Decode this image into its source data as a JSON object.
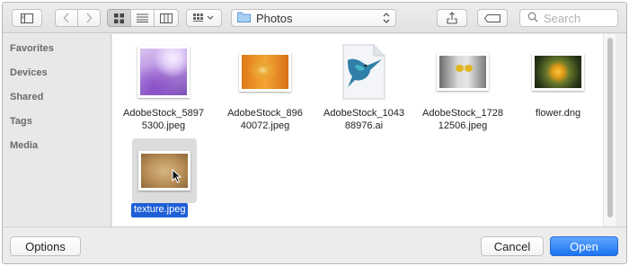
{
  "toolbar": {
    "location_label": "Photos",
    "search_placeholder": "Search"
  },
  "sidebar": {
    "items": [
      {
        "label": "Favorites"
      },
      {
        "label": "Devices"
      },
      {
        "label": "Shared"
      },
      {
        "label": "Tags"
      },
      {
        "label": "Media"
      }
    ]
  },
  "files": [
    {
      "line1": "AdobeStock_5897",
      "line2": "5300.jpeg"
    },
    {
      "line1": "AdobeStock_896",
      "line2": "40072.jpeg"
    },
    {
      "line1": "AdobeStock_1043",
      "line2": "88976.ai"
    },
    {
      "line1": "AdobeStock_1728",
      "line2": "12506.jpeg"
    },
    {
      "line1": "flower.dng",
      "line2": ""
    },
    {
      "line1": "texture.jpeg",
      "line2": ""
    }
  ],
  "footer": {
    "options_label": "Options",
    "cancel_label": "Cancel",
    "open_label": "Open"
  },
  "colors": {
    "accent": "#1a73f0",
    "selection": "#1f5fd6"
  }
}
